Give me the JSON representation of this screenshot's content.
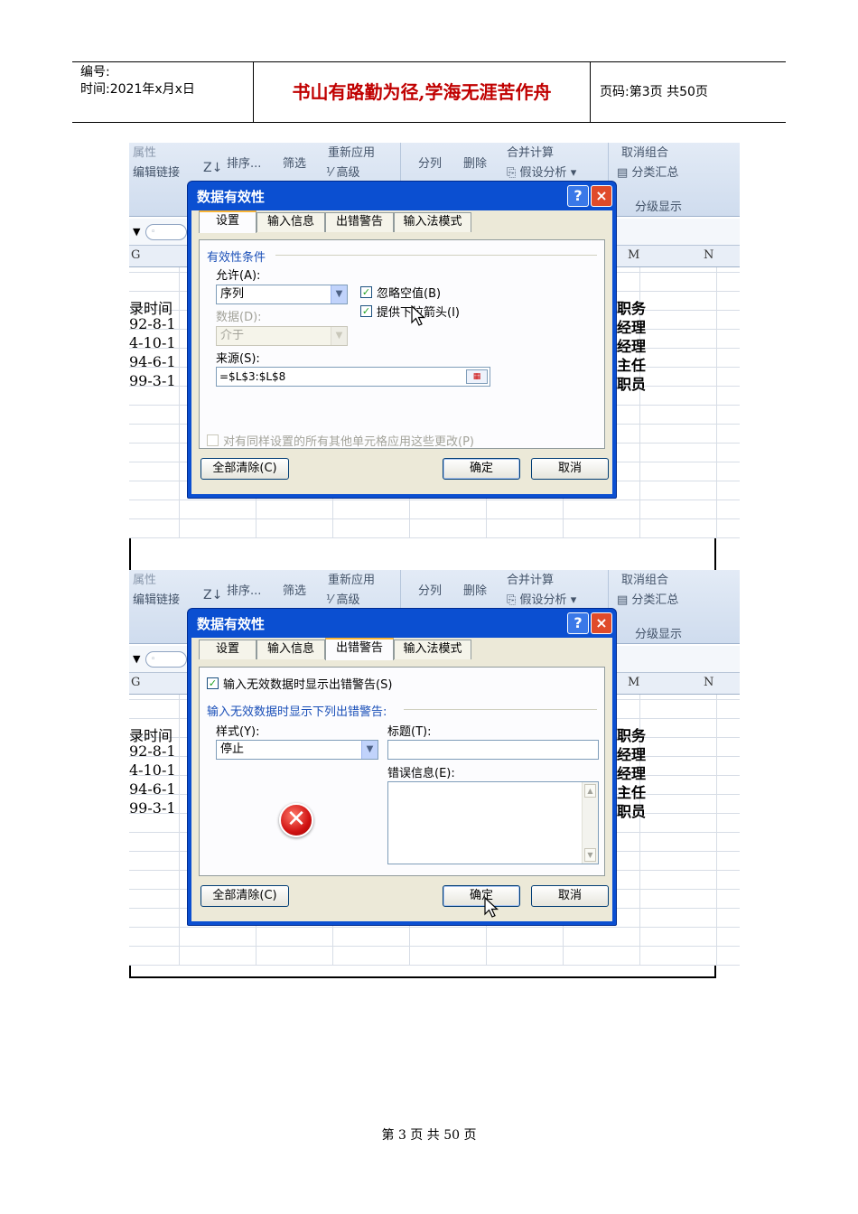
{
  "header": {
    "number_label": "编号:",
    "date_line": "时间:2021年x月x日",
    "motto": "书山有路勤为径,学海无涯苦作舟",
    "page_info": "页码:第3页 共50页"
  },
  "ribbon": {
    "edit_links": "编辑链接",
    "sort": "排序...",
    "filter": "筛选",
    "reapply": "重新应用",
    "advanced": "高级",
    "split": "分列",
    "remove": "删除",
    "merge_calc": "合并计算",
    "whatif": "假设分析",
    "ungroup": "取消组合",
    "subtotal": "分类汇总",
    "outline": "分级显示"
  },
  "sheet": {
    "col_g": "G",
    "col_m": "M",
    "col_n": "N",
    "left_cells": [
      "录时间",
      "92-8-1",
      "4-10-1",
      "94-6-1",
      "99-3-1"
    ],
    "right_cells": [
      "职务",
      "经理",
      "经理",
      "主任",
      "职员"
    ]
  },
  "dialog": {
    "title": "数据有效性",
    "help_icon": "?",
    "close_icon": "×",
    "tabs": [
      "设置",
      "输入信息",
      "出错警告",
      "输入法模式"
    ],
    "clear_all": "全部清除(C)",
    "ok": "确定",
    "cancel": "取消"
  },
  "settings_tab": {
    "section": "有效性条件",
    "allow_label": "允许(A):",
    "allow_value": "序列",
    "data_label": "数据(D):",
    "data_value": "介于",
    "ignore_blank": "忽略空值(B)",
    "in_cell_dropdown": "提供下拉箭头(I)",
    "source_label": "来源(S):",
    "source_value": "=$L$3:$L$8",
    "apply_all": "对有同样设置的所有其他单元格应用这些更改(P)"
  },
  "error_tab": {
    "show_error": "输入无效数据时显示出错警告(S)",
    "section": "输入无效数据时显示下列出错警告:",
    "style_label": "样式(Y):",
    "style_value": "停止",
    "title_label": "标题(T):",
    "message_label": "错误信息(E):"
  },
  "footer": {
    "text": "第 3 页 共 50 页"
  }
}
